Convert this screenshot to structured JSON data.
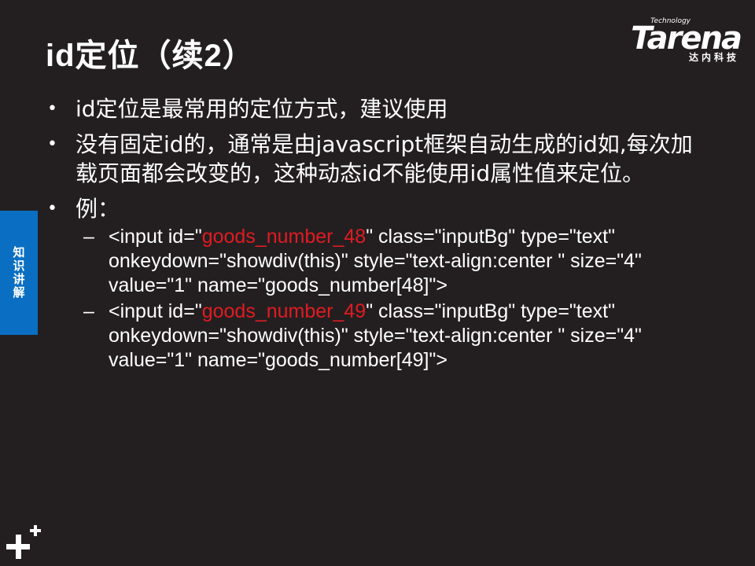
{
  "slide": {
    "title": "id定位（续2）",
    "logo": {
      "tagline": "Technology",
      "wordmark": "Tarena",
      "chinese": "达内科技"
    },
    "side_tab": "知识讲解",
    "bullets": [
      "id定位是最常用的定位方式，建议使用",
      "没有固定id的，通常是由javascript框架自动生成的id如,每次加载页面都会改变的，这种动态id不能使用id属性值来定位。",
      "例："
    ],
    "bullet_mark": "•",
    "dash_mark": "–",
    "examples": [
      {
        "before": "<input id=\"",
        "highlight": "goods_number_48",
        "after": "\" class=\"inputBg\" type=\"text\" onkeydown=\"showdiv(this)\" style=\"text-align:center \" size=\"4\" value=\"1\" name=\"goods_number[48]\">"
      },
      {
        "before": "<input id=\"",
        "highlight": "goods_number_49",
        "after": "\" class=\"inputBg\" type=\"text\" onkeydown=\"showdiv(this)\" style=\"text-align:center \" size=\"4\" value=\"1\" name=\"goods_number[49]\">"
      }
    ],
    "colors": {
      "background": "#231f20",
      "text": "#ffffff",
      "highlight": "#e11b22",
      "side_tab": "#0a6fc2"
    },
    "icons": {
      "corner": "plus-icon"
    }
  }
}
